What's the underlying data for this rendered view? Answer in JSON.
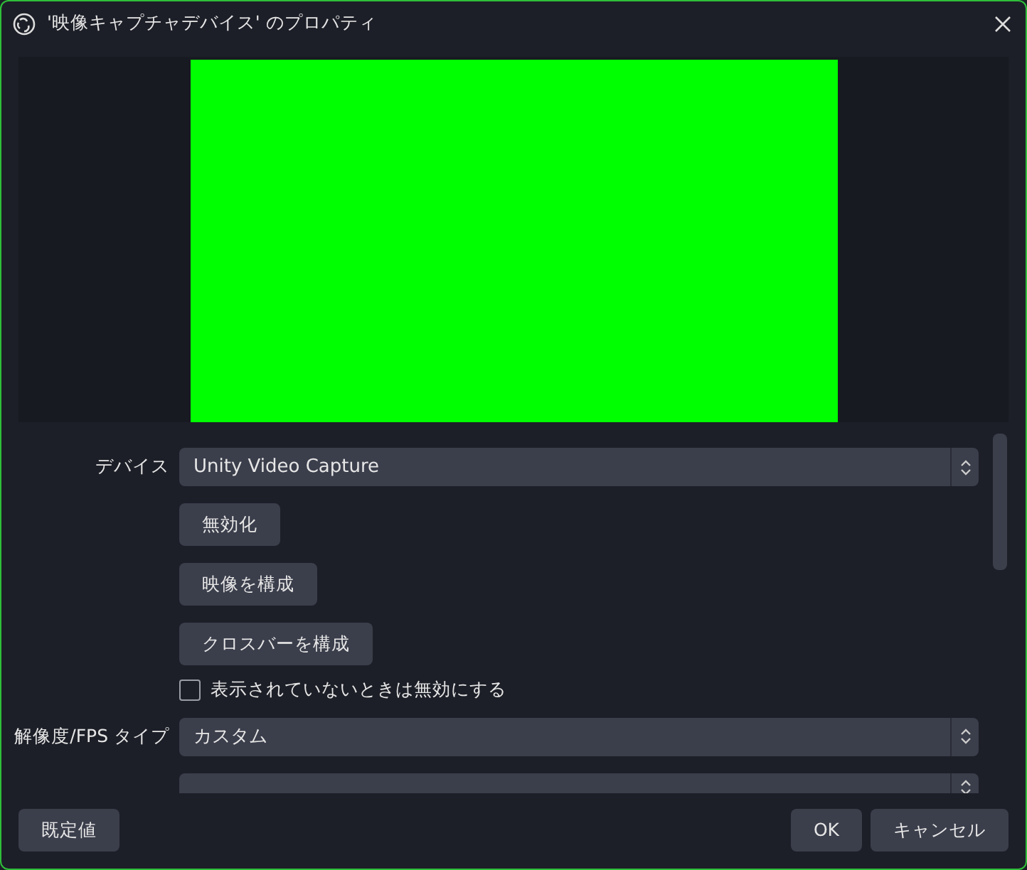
{
  "window": {
    "title": "'映像キャプチャデバイス' のプロパティ"
  },
  "preview": {
    "color": "#00ff00"
  },
  "properties": [
    {
      "kind": "select",
      "label": "デバイス",
      "value": "Unity Video Capture"
    },
    {
      "kind": "button",
      "text": "無効化"
    },
    {
      "kind": "button",
      "text": "映像を構成"
    },
    {
      "kind": "button",
      "text": "クロスバーを構成"
    },
    {
      "kind": "checkbox",
      "text": "表示されていないときは無効にする",
      "checked": false
    },
    {
      "kind": "select",
      "label": "解像度/FPS タイプ",
      "value": "カスタム"
    },
    {
      "kind": "select"
    }
  ],
  "footer": {
    "left_buttons": [
      "既定値"
    ],
    "right_buttons": [
      "OK",
      "キャンセル"
    ]
  }
}
